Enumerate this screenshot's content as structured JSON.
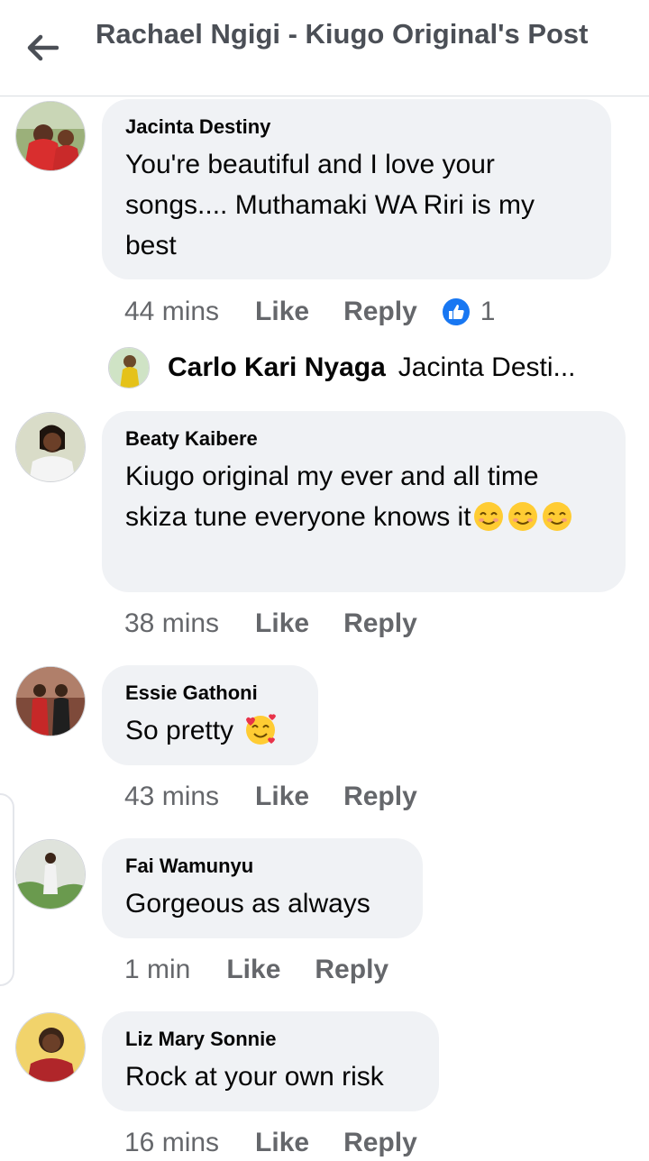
{
  "header": {
    "title": "Rachael Ngigi - Kiugo Original's Post",
    "back_icon": "back-arrow-icon"
  },
  "comments": [
    {
      "name": "Jacinta Destiny",
      "text": "You're beautiful and I love your songs.... Muthamaki WA Riri is my best",
      "time": "44 mins",
      "like": "Like",
      "reply": "Reply",
      "reaction_count": "1"
    },
    {
      "name": "Beaty Kaibere",
      "text": "Kiugo original my ever and all time skiza tune everyone knows it",
      "time": "38 mins",
      "like": "Like",
      "reply": "Reply"
    },
    {
      "name": "Essie Gathoni",
      "text": "So pretty",
      "time": "43 mins",
      "like": "Like",
      "reply": "Reply"
    },
    {
      "name": "Fai Wamunyu",
      "text": "Gorgeous as always",
      "time": "1 min",
      "like": "Like",
      "reply": "Reply"
    },
    {
      "name": "Liz Mary Sonnie",
      "text": "Rock at your own risk",
      "time": "16 mins",
      "like": "Like",
      "reply": "Reply"
    }
  ],
  "reply_preview": {
    "name": "Carlo Kari Nyaga",
    "text": "Jacinta Desti..."
  },
  "colors": {
    "accent": "#1877f2",
    "bubble": "#f0f2f5",
    "meta": "#65676b"
  }
}
